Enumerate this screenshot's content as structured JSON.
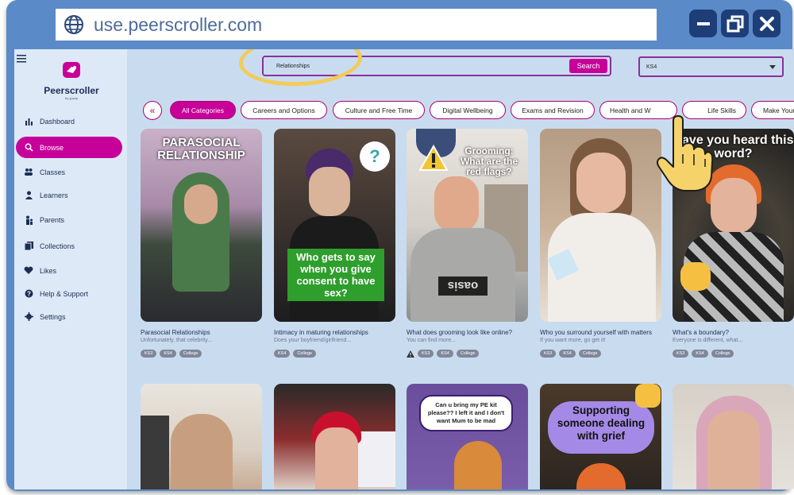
{
  "browser": {
    "url": "use.peerscroller.com"
  },
  "app": {
    "logo_name": "Peerscroller",
    "logo_sub": "by ypyap"
  },
  "sidebar": {
    "items": [
      {
        "label": "Dashboard",
        "icon": "bar-chart-icon"
      },
      {
        "label": "Browse",
        "icon": "search-icon"
      },
      {
        "label": "Classes",
        "icon": "people-icon"
      },
      {
        "label": "Learners",
        "icon": "person-icon"
      },
      {
        "label": "Parents",
        "icon": "parent-icon"
      },
      {
        "label": "Collections",
        "icon": "collection-icon"
      },
      {
        "label": "Likes",
        "icon": "heart-icon"
      },
      {
        "label": "Help & Support",
        "icon": "help-icon"
      },
      {
        "label": "Settings",
        "icon": "gear-icon"
      }
    ]
  },
  "search": {
    "value": "Relationships",
    "button": "Search"
  },
  "filter": {
    "selected": "KS4"
  },
  "categories": [
    "All Categories",
    "Careers and Options",
    "Culture and Free Time",
    "Digital Wellbeing",
    "Exams and Revision",
    "Health and W",
    "Life Skills",
    "Make Your V"
  ],
  "cards": [
    {
      "overlay": "PARASOCIAL RELATIONSHIP",
      "title": "Parasocial Relationships",
      "desc": "Unfortunately, that celebrity...",
      "tags": [
        "KS3",
        "KS4",
        "College"
      ]
    },
    {
      "overlay": "Who gets to say when you give consent to have sex?",
      "title": "Intimacy in maturing relationships",
      "desc": "Does your boyfriend/girlfriend...",
      "tags": [
        "KS4",
        "College"
      ]
    },
    {
      "overlay": "Grooming: What are the red flags?",
      "title": "What does grooming look like online?",
      "desc": "You can find more...",
      "tags": [
        "KS3",
        "KS4",
        "College"
      ],
      "shirt": "oasis"
    },
    {
      "overlay": "",
      "title": "Who you surround yourself with matters",
      "desc": "If you want more, go get it!",
      "tags": [
        "KS3",
        "KS4",
        "College"
      ]
    },
    {
      "overlay": "Have you heard this word?",
      "title": "What's a boundary?",
      "desc": "Everyone is different, what...",
      "tags": [
        "KS3",
        "KS4",
        "College"
      ]
    }
  ],
  "cards_row2": [
    {
      "overlay": ""
    },
    {
      "overlay": ""
    },
    {
      "overlay": "Can u bring my PE kit please?? I left it and I don't want Mum to be mad"
    },
    {
      "overlay": "Supporting someone dealing with grief"
    },
    {
      "overlay": ""
    }
  ],
  "colors": {
    "accent": "#c8009a",
    "frame": "#5b8ac8",
    "content": "#c9dcef",
    "sidebar": "#dde9f7",
    "highlight": "#f2cb59"
  }
}
